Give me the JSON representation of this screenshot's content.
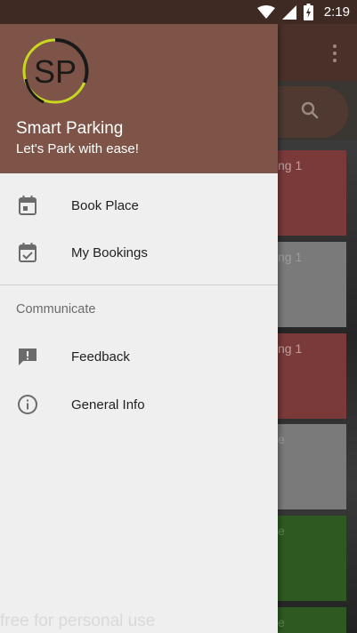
{
  "status_bar": {
    "time": "2:19",
    "icons": [
      "wifi-icon",
      "signal-icon",
      "battery-charging-icon"
    ]
  },
  "background_app": {
    "cards": [
      {
        "text": "ng 1",
        "color": "#7a3a3a"
      },
      {
        "text": "ng 1",
        "color": "#7a7a7a"
      },
      {
        "text": "ng 1",
        "color": "#7a3a3a"
      },
      {
        "text": "e",
        "color": "#7a7a7a"
      },
      {
        "text": "e",
        "color": "#2e5a22"
      },
      {
        "text": "e",
        "color": "#2e5a22"
      }
    ]
  },
  "drawer": {
    "header": {
      "logo_text": "SP",
      "app_name": "Smart Parking",
      "tagline": "Let's Park with ease!",
      "background_color": "#7d5447"
    },
    "menu": [
      {
        "label": "Book Place",
        "icon": "calendar-icon"
      },
      {
        "label": "My Bookings",
        "icon": "calendar-check-icon"
      }
    ],
    "section_title": "Communicate",
    "section_items": [
      {
        "label": "Feedback",
        "icon": "feedback-icon"
      },
      {
        "label": "General Info",
        "icon": "info-icon"
      }
    ]
  },
  "watermark": "free for personal use"
}
